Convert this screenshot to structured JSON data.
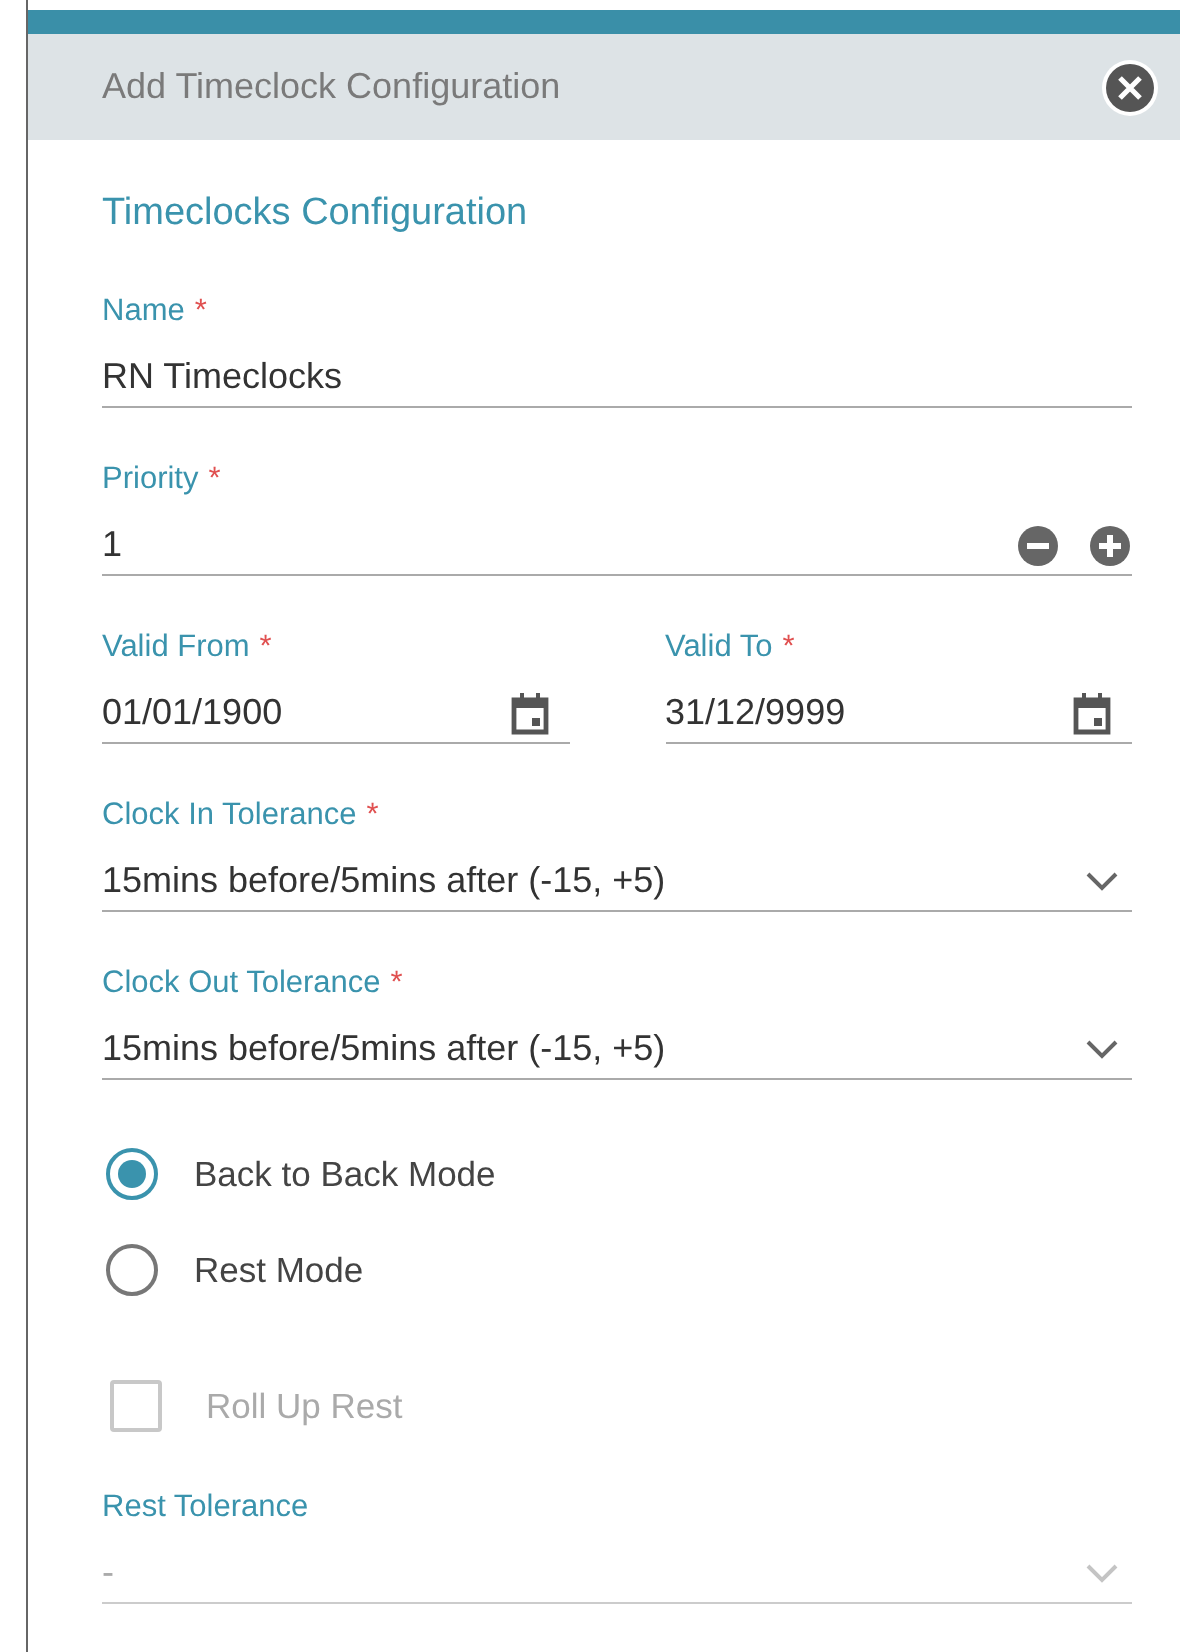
{
  "dialog": {
    "title": "Add Timeclock Configuration"
  },
  "section_title": "Timeclocks Configuration",
  "fields": [
    {
      "kind": "text",
      "label": "Name",
      "required_mark": "*",
      "value": "RN Timeclocks"
    },
    {
      "kind": "stepper",
      "label": "Priority",
      "required_mark": "*",
      "value": "1"
    },
    {
      "kind": "date_pair",
      "items": [
        {
          "label": "Valid From",
          "required_mark": "*",
          "value": "01/01/1900"
        },
        {
          "label": "Valid To",
          "required_mark": "*",
          "value": "31/12/9999"
        }
      ]
    },
    {
      "kind": "select",
      "label": "Clock In Tolerance",
      "required_mark": "*",
      "value": "15mins before/5mins after (-15, +5)",
      "disabled": false
    },
    {
      "kind": "select",
      "label": "Clock Out Tolerance",
      "required_mark": "*",
      "value": "15mins before/5mins after (-15, +5)",
      "disabled": false
    }
  ],
  "modes": [
    {
      "label": "Back to Back Mode",
      "selected": true
    },
    {
      "label": "Rest Mode",
      "selected": false
    }
  ],
  "roll_up_rest": {
    "label": "Roll Up Rest",
    "checked": false,
    "disabled": true
  },
  "rest_tolerance": {
    "kind": "select",
    "label": "Rest Tolerance",
    "value": "-",
    "disabled": true
  }
}
